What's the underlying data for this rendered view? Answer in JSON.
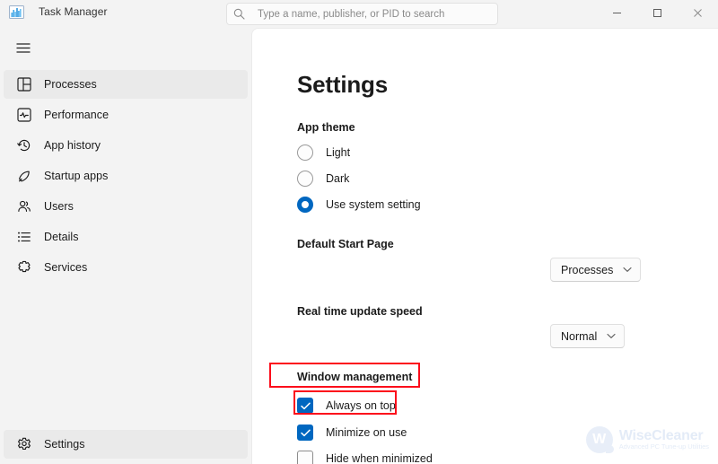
{
  "window": {
    "app_title": "Task Manager",
    "app_icon": "task-manager-chart-icon",
    "controls": {
      "minimize": "─",
      "maximize": "□",
      "close": "✕"
    }
  },
  "search": {
    "placeholder": "Type a name, publisher, or PID to search",
    "value": "",
    "icon": "search-icon"
  },
  "sidebar": {
    "hamburger_label": "Open navigation",
    "items": [
      {
        "label": "Processes",
        "icon": "processes-icon",
        "selected": true
      },
      {
        "label": "Performance",
        "icon": "performance-icon",
        "selected": false
      },
      {
        "label": "App history",
        "icon": "app-history-icon",
        "selected": false
      },
      {
        "label": "Startup apps",
        "icon": "startup-apps-icon",
        "selected": false
      },
      {
        "label": "Users",
        "icon": "users-icon",
        "selected": false
      },
      {
        "label": "Details",
        "icon": "details-icon",
        "selected": false
      },
      {
        "label": "Services",
        "icon": "services-icon",
        "selected": false
      }
    ],
    "bottom_item": {
      "label": "Settings",
      "icon": "gear-icon",
      "selected": true
    }
  },
  "main": {
    "title": "Settings",
    "app_theme": {
      "label": "App theme",
      "options": [
        {
          "label": "Light",
          "checked": false
        },
        {
          "label": "Dark",
          "checked": false
        },
        {
          "label": "Use system setting",
          "checked": true
        }
      ]
    },
    "default_start_page": {
      "label": "Default Start Page",
      "value": "Processes"
    },
    "update_speed": {
      "label": "Real time update speed",
      "value": "Normal"
    },
    "window_management": {
      "label": "Window management",
      "checkboxes": [
        {
          "label": "Always on top",
          "checked": true
        },
        {
          "label": "Minimize on use",
          "checked": true
        },
        {
          "label": "Hide when minimized",
          "checked": false
        }
      ]
    }
  },
  "annotations": {
    "color": "#fc0d1b",
    "boxes": [
      {
        "target": "window-management-heading"
      },
      {
        "target": "always-on-top-checkbox"
      }
    ]
  },
  "watermark": {
    "initial": "W",
    "name": "WiseCleaner",
    "tagline": "Advanced PC Tune-up Utilities"
  },
  "colors": {
    "accent": "#0067c0",
    "annotation": "#fc0d1b",
    "sidebar_bg": "#f3f3f3",
    "content_bg": "#ffffff"
  }
}
